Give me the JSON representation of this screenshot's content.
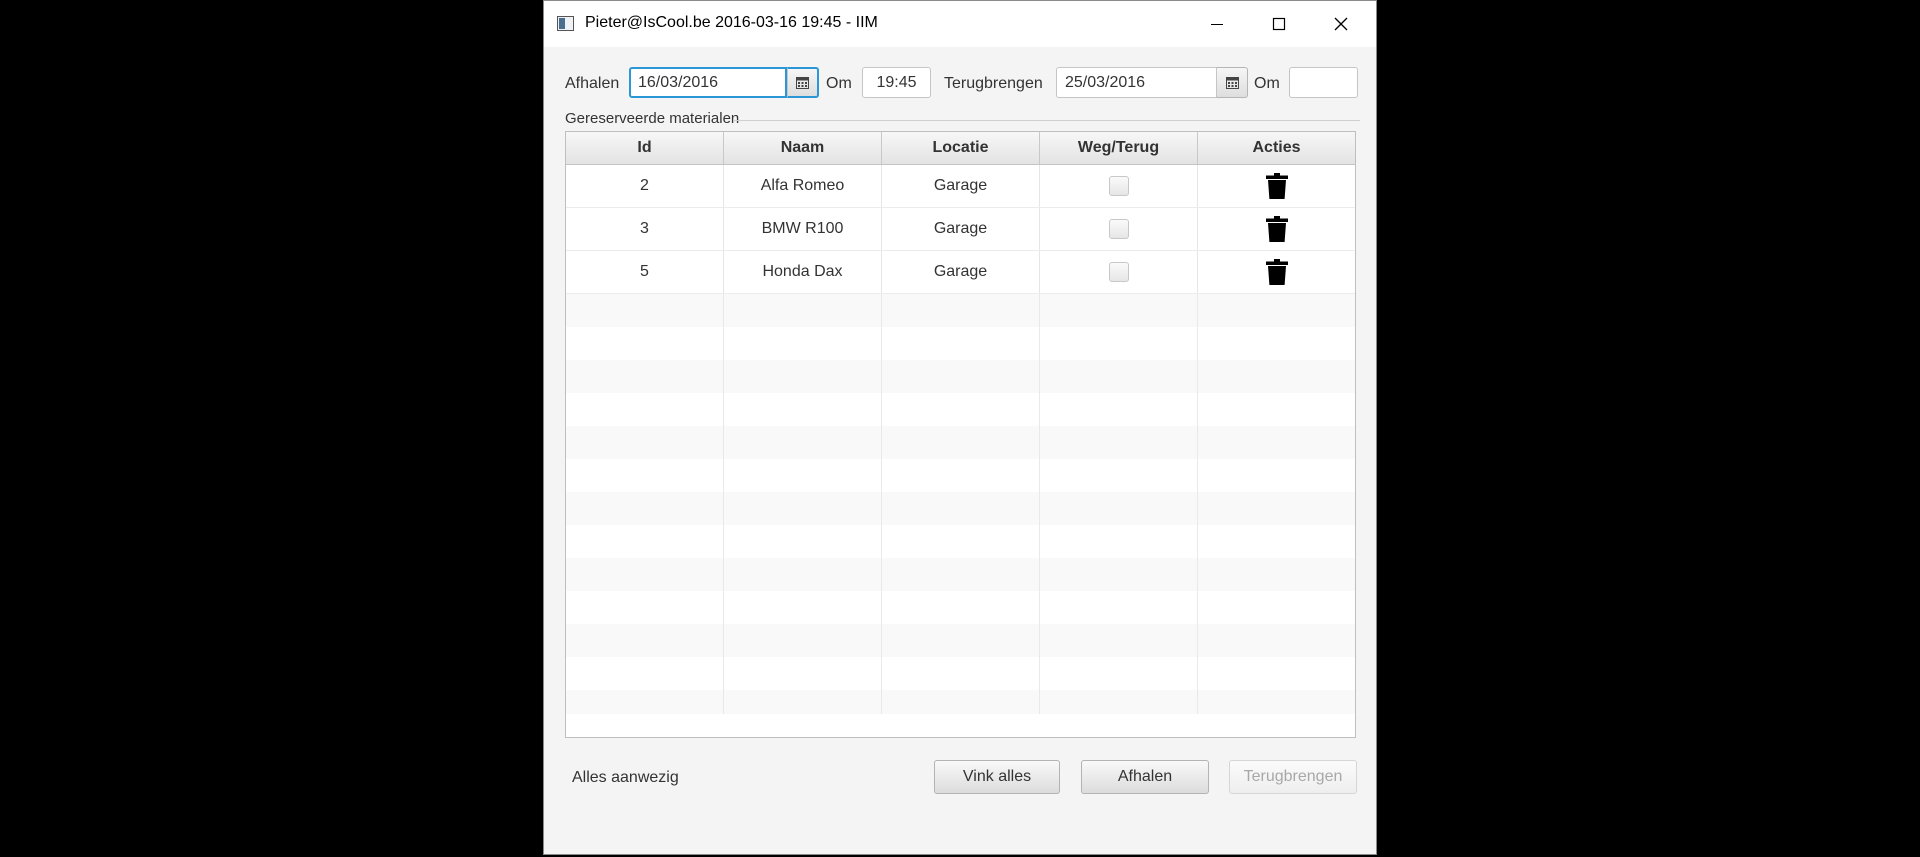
{
  "window": {
    "title": "Pieter@IsCool.be 2016-03-16 19:45 - IIM"
  },
  "form": {
    "pickup_label": "Afhalen",
    "pickup_date": "16/03/2016",
    "pickup_time_label": "Om",
    "pickup_time": "19:45",
    "return_label": "Terugbrengen",
    "return_date": "25/03/2016",
    "return_time_label": "Om",
    "return_time": ""
  },
  "section": {
    "title": "Gereserveerde materialen"
  },
  "table": {
    "columns": [
      "Id",
      "Naam",
      "Locatie",
      "Weg/Terug",
      "Acties"
    ],
    "rows": [
      {
        "id": "2",
        "name": "Alfa Romeo",
        "location": "Garage",
        "checked": false,
        "action_icon": "trash-icon"
      },
      {
        "id": "3",
        "name": "BMW R100",
        "location": "Garage",
        "checked": false,
        "action_icon": "trash-icon"
      },
      {
        "id": "5",
        "name": "Honda Dax",
        "location": "Garage",
        "checked": false,
        "action_icon": "trash-icon"
      }
    ]
  },
  "footer": {
    "status": "Alles aanwezig",
    "check_all_label": "Vink alles",
    "pickup_button_label": "Afhalen",
    "return_button_label": "Terugbrengen"
  },
  "colors": {
    "focus_border": "#2c97d6",
    "window_background": "#f4f4f4"
  }
}
